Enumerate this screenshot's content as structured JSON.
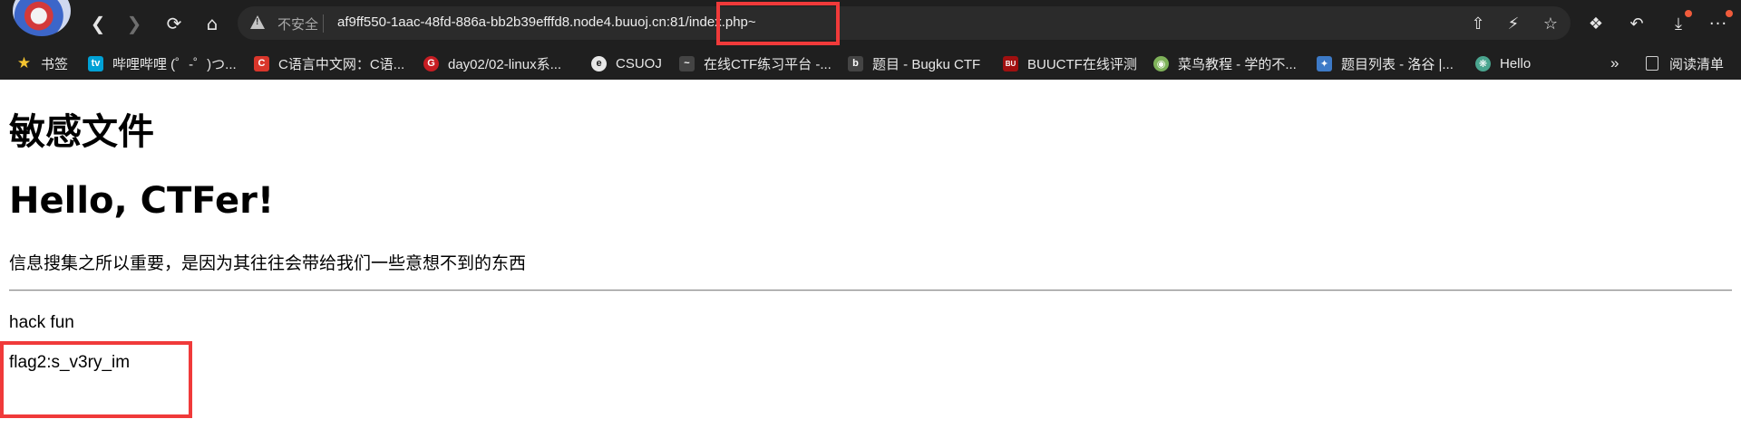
{
  "browser": {
    "address_bar": {
      "security_label": "不安全",
      "url_host": "af9ff550-1aac-48fd-886a-bb2b39efffd8.node4.buuoj.cn:81",
      "url_path": "/index.php~"
    },
    "icons": [
      "back-icon",
      "forward-icon",
      "refresh-icon",
      "home-icon",
      "share-icon",
      "performance-icon",
      "favorite-icon",
      "extensions-icon",
      "undo-icon",
      "downloads-icon",
      "more-icon"
    ],
    "highlight_color": "#f03a3a"
  },
  "bookmarks": {
    "items": [
      {
        "label": "书签",
        "icon": "star-icon",
        "color": "#f4c430"
      },
      {
        "label": "哔哩哔哩 (゜-゜)つ...",
        "icon": "bilibili-icon",
        "color": "#00a1d6"
      },
      {
        "label": "C语言中文网：C语...",
        "icon": "c-icon",
        "color": "#d9362b"
      },
      {
        "label": "day02/02-linux系...",
        "icon": "gitee-icon",
        "color": "#c71d23"
      },
      {
        "label": "CSUOJ",
        "icon": "csuoj-icon",
        "color": "#e8e8e8"
      },
      {
        "label": "在线CTF练习平台 -...",
        "icon": "ctf-icon",
        "color": "#444444"
      },
      {
        "label": "题目 - Bugku CTF",
        "icon": "bugku-icon",
        "color": "#444444"
      },
      {
        "label": "BUUCTF在线评测",
        "icon": "buuctf-icon",
        "color": "#a01010"
      },
      {
        "label": "菜鸟教程 - 学的不...",
        "icon": "runoob-icon",
        "color": "#7fb25a"
      },
      {
        "label": "题目列表 - 洛谷 |...",
        "icon": "luogu-icon",
        "color": "#3d7ac7"
      },
      {
        "label": "Hello",
        "icon": "chatgpt-icon",
        "color": "#4aa58f"
      }
    ],
    "overflow_label": "»",
    "reading_list_label": "阅读清单"
  },
  "page": {
    "heading1": "敏感文件",
    "heading2": "Hello, CTFer!",
    "intro": "信息搜集之所以重要，是因为其往往会带给我们一些意想不到的东西",
    "line1": "hack fun",
    "line2": "flag2:s_v3ry_im"
  }
}
